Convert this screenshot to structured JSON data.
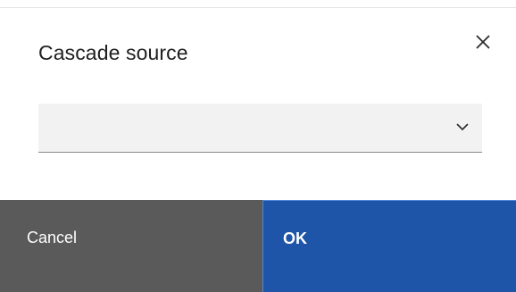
{
  "dialog": {
    "title": "Cascade source",
    "close_icon": "close-icon",
    "select": {
      "selected_value": "",
      "chevron_icon": "chevron-down-icon"
    },
    "buttons": {
      "cancel_label": "Cancel",
      "ok_label": "OK"
    }
  },
  "colors": {
    "cancel_bg": "#5a5a5a",
    "ok_bg": "#1e55a8",
    "field_bg": "#f2f2f2"
  }
}
